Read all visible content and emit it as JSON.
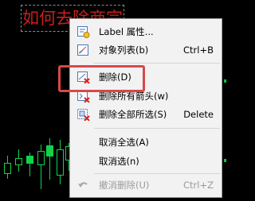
{
  "chart": {
    "title": "如何去除商宗"
  },
  "context_menu": {
    "items": [
      {
        "label": "Label 属性...",
        "shortcut": "",
        "icon": "label-properties-icon",
        "enabled": true
      },
      {
        "label": "对象列表(b)",
        "shortcut": "Ctrl+B",
        "icon": "object-list-icon",
        "enabled": true
      },
      {
        "label": "删除(D)",
        "shortcut": "",
        "icon": "delete-icon",
        "enabled": true
      },
      {
        "label": "删除所有箭头(w)",
        "shortcut": "",
        "icon": "delete-all-arrows-icon",
        "enabled": true
      },
      {
        "label": "删除全部所选(S)",
        "shortcut": "Delete",
        "icon": "delete-all-selected-icon",
        "enabled": true
      },
      {
        "label": "取消全选(A)",
        "shortcut": "",
        "icon": "",
        "enabled": true
      },
      {
        "label": "取消选(n)",
        "shortcut": "",
        "icon": "",
        "enabled": true
      },
      {
        "label": "撤消删除(U)",
        "shortcut": "Ctrl+Z",
        "icon": "undo-icon",
        "enabled": false
      }
    ]
  },
  "colors": {
    "chart_background": "#000000",
    "candle_color": "#12d24a",
    "title_color": "#c81e1e",
    "highlight_border": "#d9484a"
  }
}
